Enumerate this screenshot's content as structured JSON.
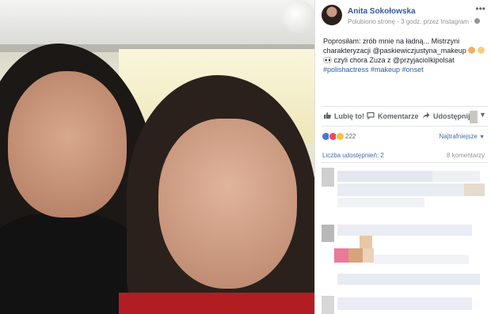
{
  "post": {
    "author": "Anita Sokołowska",
    "meta": "Polubiono stronę · 3 godz. przez Instagram · ",
    "more_icon": "more-icon",
    "caption_line1": "Poprosiłam: zrób mnie na ładną... Mistrzyni charakteryzacji @paskiewiczjustyna_makeup ",
    "caption_line2": " czyli chora Zuza z @przyjacioIkipolsat",
    "hashtags": "#polishactress #makeup #onset"
  },
  "actions": {
    "like": "Lubię to!",
    "comment": "Komentarze",
    "share": "Udostępnij"
  },
  "reactions": {
    "count": "222",
    "sort": "Najtrafniejsze"
  },
  "stats": {
    "shares": "Liczba udostępnień: 2",
    "comments": "8 komentarzy"
  },
  "colors": {
    "link": "#365899",
    "muted": "#90949c",
    "like": "#4a75d6",
    "love": "#f0475d",
    "haha": "#f5c33b"
  }
}
